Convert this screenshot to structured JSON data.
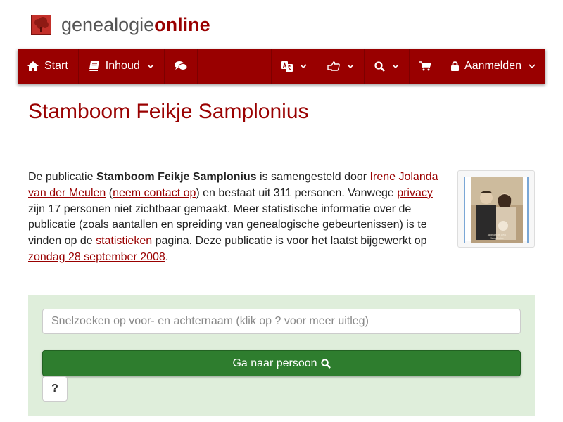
{
  "logo": {
    "part1": "genealogie",
    "part2": "online"
  },
  "nav": {
    "start": "Start",
    "inhoud": "Inhoud",
    "login": "Aanmelden",
    "icons": [
      "home-icon",
      "book-icon",
      "comments-icon",
      "language-icon",
      "share-icon",
      "search-icon",
      "cart-icon",
      "lock-icon"
    ]
  },
  "page": {
    "title": "Stamboom Feikje Samplonius"
  },
  "intro": {
    "t1": "De publicatie ",
    "title_bold": "Stamboom Feikje Samplonius",
    "t2": " is samengesteld door ",
    "author_link": "Irene Jolanda van der Meulen",
    "t3": " (",
    "contact_link": "neem contact op",
    "t4": ") en bestaat uit 311 personen. Vanwege ",
    "privacy_link": "privacy",
    "t5": " zijn 17 personen niet zichtbaar gemaakt. Meer statistische informatie over de publicatie (zoals aantallen en spreiding van genealogische gebeurtenissen) is te vinden op de ",
    "stats_link": "statistieken",
    "t6": " pagina. Deze publicatie is voor het laatst bijgewerkt op ",
    "date_link": "zondag 28 september 2008",
    "t7": "."
  },
  "search": {
    "placeholder": "Snelzoeken op voor- en achternaam (klik op ? voor meer uitleg)",
    "value": "",
    "button_label": "Ga naar persoon",
    "help_label": "?"
  },
  "colors": {
    "brand": "#990000",
    "panel": "#dfeedb",
    "button": "#2e7d2e"
  }
}
